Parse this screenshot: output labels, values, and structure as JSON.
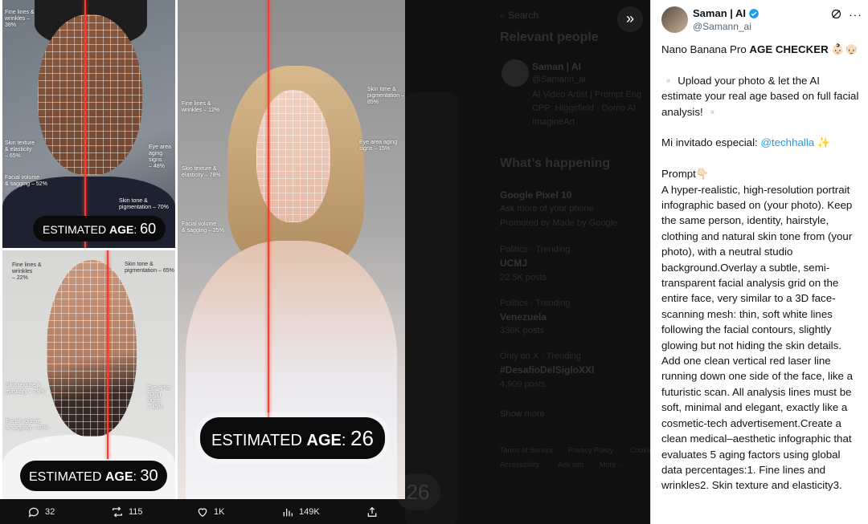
{
  "background": {
    "search_placeholder": "Search",
    "relevant_people_heading": "Relevant people",
    "rp_name": "Saman | AI",
    "rp_handle": "@Samann_ai",
    "rp_bio": [
      "AI Video Artist | Prompt Eng",
      "CPP: Higgsfield · Domo AI",
      "ImagineArt"
    ],
    "happening_heading": "What’s happening",
    "trends": [
      {
        "title": "Google Pixel 10",
        "meta": "Ask more of your phone",
        "extra": "Promoted by Made by Google"
      },
      {
        "meta": "Politics · Trending",
        "title": "UCMJ",
        "extra": "22.5K posts"
      },
      {
        "meta": "Politics · Trending",
        "title": "Venezuela",
        "extra": "336K posts"
      },
      {
        "meta": "Only on X · Trending",
        "title": "#DesafioDelSigloXXI",
        "extra": "4,909 posts"
      }
    ],
    "show_more": "Show more",
    "footer_links": [
      "Terms of Service",
      "Privacy Policy",
      "Cookie",
      "Accessibility",
      "Ads info",
      "More ···"
    ],
    "bg_estimate": "26"
  },
  "collage": {
    "panel1": {
      "labels": [
        "Fine lines &\nwrinkles –\n38%",
        "Skin texture\n& elasticity\n– 65%",
        "Eye area\naging signs\n– 48%",
        "Facial volume\n& sagging – 52%",
        "Skin tone &\npigmentation – 70%"
      ],
      "estimate_label": "ESTIMATED",
      "estimate_key": "AGE",
      "estimate_value": "60"
    },
    "panel2": {
      "labels": [
        "Fine lines &\nwrinkles\n– 22%",
        "Skin tone &\npigmentation – 65%",
        "Skin texture &\nelasticity – 78%",
        "Eye area\naging signs\n– 45%",
        "Facial volume\n& sagging – 30%"
      ],
      "estimate_label": "ESTIMATED",
      "estimate_key": "AGE",
      "estimate_value": "30"
    },
    "panel3": {
      "labels": [
        "Skin tone &\npigmentation – 85%",
        "Fine lines &\nwrinkles – 12%",
        "Eye area aging\nsigns – 15%",
        "Skin texture &\nelasticity – 78%",
        "Facial volume\n& sagging – 25%"
      ],
      "estimate_label": "ESTIMATED",
      "estimate_key": "AGE",
      "estimate_value": "26"
    }
  },
  "actions": {
    "replies": "32",
    "reposts": "115",
    "likes": "1K",
    "views": "149K"
  },
  "tweet": {
    "name": "Saman | AI",
    "handle": "@Samann_ai",
    "title_prefix": "Nano Banana Pro ",
    "title_bold": "AGE CHECKER",
    "title_emoji": " 👶🏻👴🏻",
    "p1": "▫️ Upload your photo & let the AI estimate your real age based on full facial analysis! ▫️",
    "guest_prefix": "Mi invitado especial: ",
    "guest_mention": "@techhalla",
    "guest_emoji": " ✨",
    "prompt_label": "Prompt👇🏻",
    "prompt_text": "A hyper-realistic, high-resolution portrait infographic based on (your photo). Keep the same person, identity, hairstyle, clothing and natural skin tone from (your photo), with a neutral studio background.Overlay a subtle, semi-transparent facial analysis grid on the entire face, very similar to a 3D face-scanning mesh: thin, soft white lines following the facial contours, slightly glowing but not hiding the skin details. Add one clean vertical red laser line running down one side of the face, like a futuristic scan. All analysis lines must be soft, minimal and elegant, exactly like a cosmetic-tech advertisement.Create a clean medical–aesthetic infographic that evaluates 5 aging factors using global data percentages:1. Fine lines and wrinkles2. Skin texture and elasticity3."
  }
}
